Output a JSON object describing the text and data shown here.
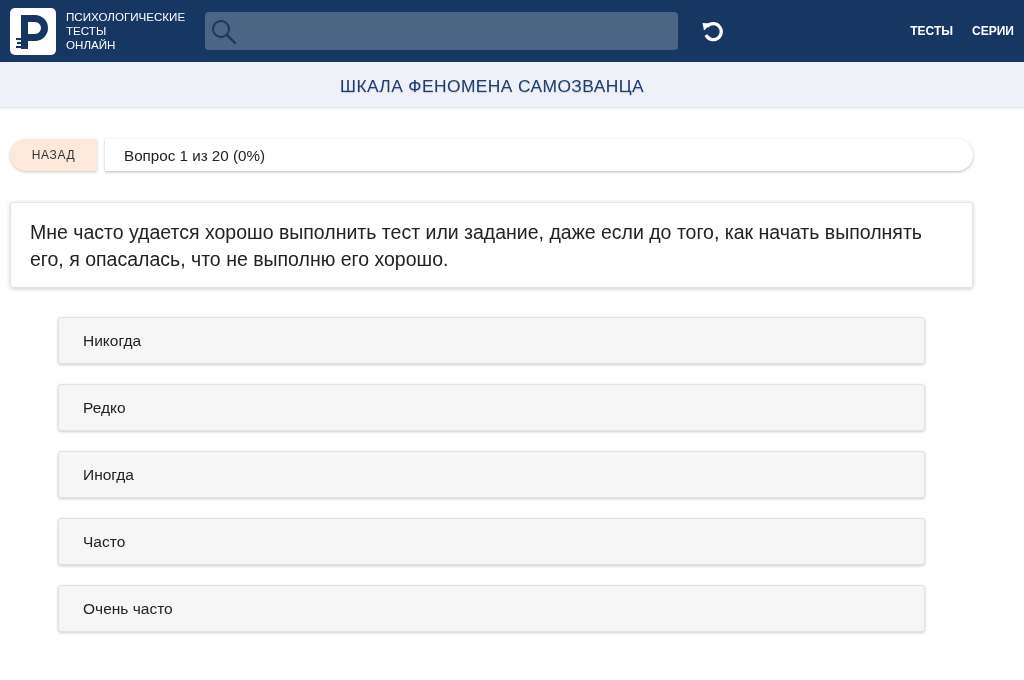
{
  "header": {
    "brand_lines": [
      "ПСИХОЛОГИЧЕСКИЕ",
      "ТЕСТЫ",
      "ОНЛАЙН"
    ],
    "nav": [
      "ТЕСТЫ",
      "СЕРИИ"
    ]
  },
  "title": "ШКАЛА ФЕНОМЕНА САМОЗВАНЦА",
  "progress": {
    "back_button": "НАЗАД",
    "text": "Вопрос 1 из 20 (0%)"
  },
  "question": {
    "text": "Мне часто удается хорошо выполнить тест или задание, даже если до того, как начать выполнять его, я опасалась, что не выполню его хорошо."
  },
  "answers": [
    {
      "label": "Никогда",
      "selected": false
    },
    {
      "label": "Редко",
      "selected": false
    },
    {
      "label": "Иногда",
      "selected": false
    },
    {
      "label": "Часто",
      "selected": false
    },
    {
      "label": "Очень часто",
      "selected": false
    }
  ]
}
